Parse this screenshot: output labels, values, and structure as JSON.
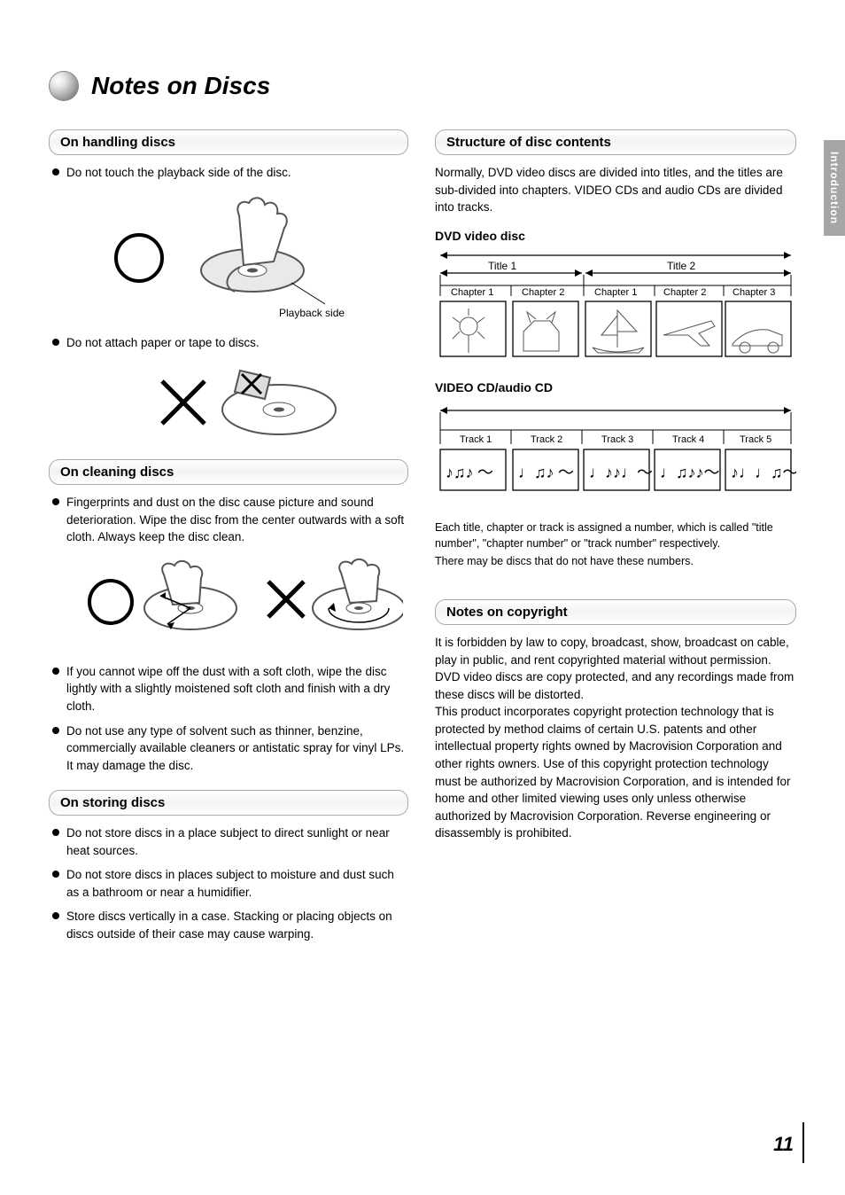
{
  "side_tab": "Introduction",
  "title": "Notes on Discs",
  "page_number": "11",
  "left": {
    "handling": {
      "header": "On handling discs",
      "bullets": [
        "Do not touch the playback side of the disc.",
        "Do not attach paper or tape to discs."
      ],
      "fig1_caption": "Playback side"
    },
    "cleaning": {
      "header": "On cleaning discs",
      "bullets": [
        "Fingerprints and dust on the disc cause picture and sound deterioration. Wipe the disc from the center outwards with a soft cloth. Always keep the disc clean.",
        "If you cannot wipe off the dust with a soft cloth, wipe the disc lightly with a slightly moistened soft cloth and finish with a dry cloth.",
        "Do not use any type of solvent such as thinner, benzine, commercially available cleaners or antistatic spray for vinyl LPs. It may damage the disc."
      ]
    },
    "storing": {
      "header": "On storing discs",
      "bullets": [
        "Do not store discs in a place subject to direct sunlight or near heat sources.",
        "Do not store discs in places subject to moisture and dust such as a bathroom or near a humidifier.",
        "Store discs vertically in a case. Stacking or placing objects on discs outside of their case may cause warping."
      ]
    }
  },
  "right": {
    "structure": {
      "header": "Structure of disc contents",
      "intro": "Normally, DVD video discs are divided into titles, and the titles are sub-divided into chapters. VIDEO CDs and audio CDs are divided into tracks.",
      "dvd": {
        "label": "DVD video disc",
        "title1": "Title 1",
        "title2": "Title 2",
        "ch1": "Chapter 1",
        "ch2": "Chapter 2",
        "ch3": "Chapter 1",
        "ch4": "Chapter 2",
        "ch5": "Chapter 3"
      },
      "cd": {
        "label": "VIDEO CD/audio CD",
        "t1": "Track 1",
        "t2": "Track 2",
        "t3": "Track 3",
        "t4": "Track 4",
        "t5": "Track 5"
      },
      "para2": "Each title, chapter or track is assigned a number, which is called \"title number\", \"chapter number\" or \"track number\" respectively.",
      "para3": "There may be discs that do not have these numbers."
    },
    "copyright": {
      "header": "Notes on copyright",
      "body": "It is forbidden by law to copy, broadcast, show, broadcast on cable, play in public, and rent copyrighted material without permission.\nDVD video discs are copy protected, and any recordings made from these discs will be distorted.\nThis product incorporates copyright protection technology that is protected by method claims of certain U.S. patents and other intellectual property rights owned by Macrovision Corporation and other rights owners. Use of this copyright protection technology must be authorized by Macrovision Corporation, and is intended for home and other limited viewing uses only unless otherwise authorized by Macrovision Corporation. Reverse engineering or disassembly is prohibited."
    }
  }
}
